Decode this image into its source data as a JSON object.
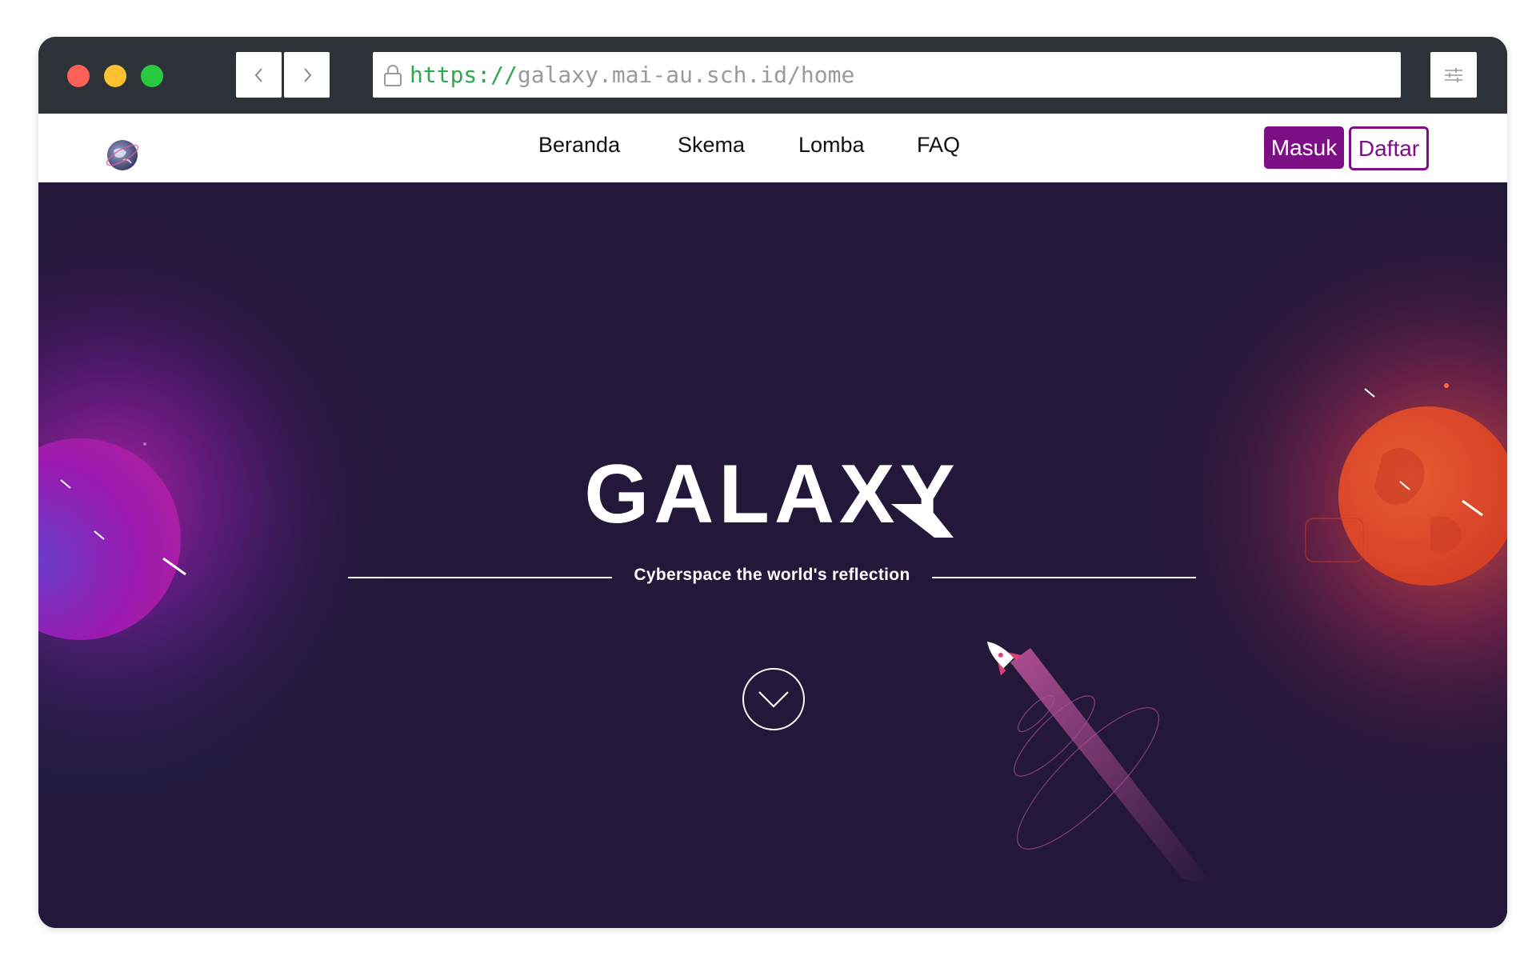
{
  "browser": {
    "url_scheme": "https://",
    "url_host": "galaxy.mai-au.sch.id/home"
  },
  "nav": {
    "links": [
      "Beranda",
      "Skema",
      "Lomba",
      "FAQ"
    ],
    "masuk_label": "Masuk",
    "daftar_label": "Daftar"
  },
  "hero": {
    "title": "GALAXY",
    "tagline": "Cyberspace the world's reflection"
  },
  "colors": {
    "accent": "#7d0f86",
    "hero_bg": "#23173a",
    "planet_left": "#9b1ab0",
    "planet_right": "#e0452a"
  },
  "icons": {
    "back": "chevron-left-icon",
    "forward": "chevron-right-icon",
    "lock": "lock-icon",
    "menu": "settings-sliders-icon",
    "scroll": "chevron-down-icon"
  }
}
